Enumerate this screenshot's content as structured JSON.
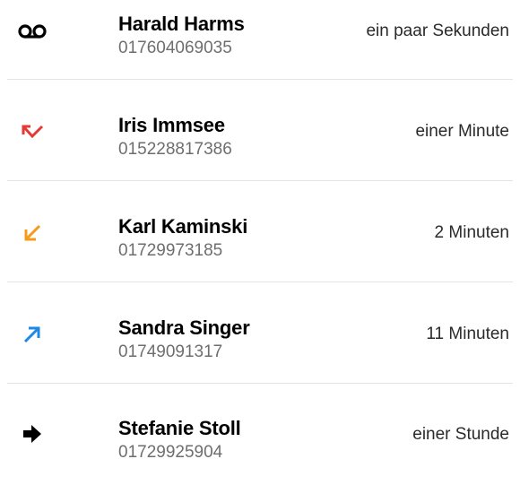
{
  "calls": [
    {
      "name": "Harald Harms",
      "number": "017604069035",
      "time": "ein paar Sekunden",
      "type_icon": "voicemail-icon",
      "icon_color": "#000000"
    },
    {
      "name": "Iris Immsee",
      "number": "015228817386",
      "time": "einer Minute",
      "type_icon": "missed-call-icon",
      "icon_color": "#e53935"
    },
    {
      "name": "Karl Kaminski",
      "number": "01729973185",
      "time": "2 Minuten",
      "type_icon": "incoming-call-icon",
      "icon_color": "#f59b1b"
    },
    {
      "name": "Sandra Singer",
      "number": "01749091317",
      "time": "11 Minuten",
      "type_icon": "outgoing-call-icon",
      "icon_color": "#1e88e5"
    },
    {
      "name": "Stefanie Stoll",
      "number": "01729925904",
      "time": "einer Stunde",
      "type_icon": "forwarded-call-icon",
      "icon_color": "#000000"
    }
  ]
}
